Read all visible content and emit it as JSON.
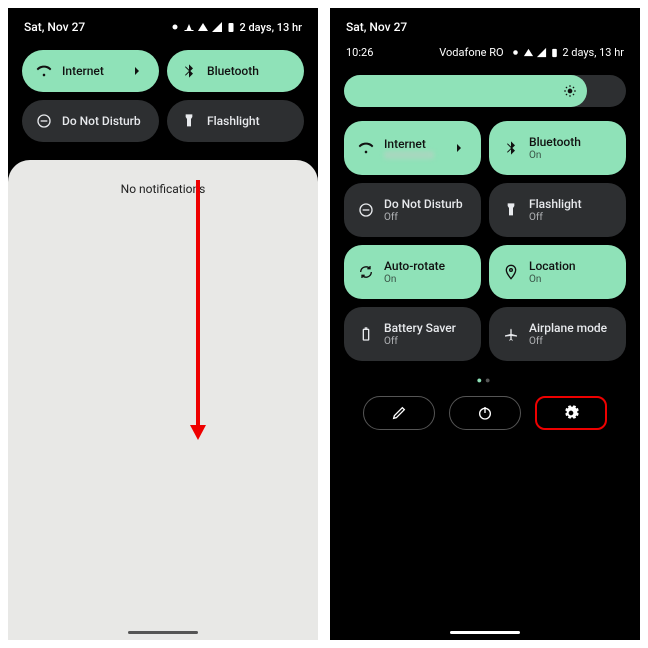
{
  "left": {
    "date": "Sat, Nov 27",
    "battery_text": "2 days, 13 hr",
    "tiles": [
      {
        "label": "Internet",
        "state": "on",
        "icon": "wifi"
      },
      {
        "label": "Bluetooth",
        "state": "on",
        "icon": "bluetooth"
      },
      {
        "label": "Do Not Disturb",
        "state": "off",
        "icon": "dnd"
      },
      {
        "label": "Flashlight",
        "state": "off",
        "icon": "flashlight"
      }
    ],
    "no_notifications": "No notifications"
  },
  "right": {
    "date": "Sat, Nov 27",
    "time": "10:26",
    "carrier": "Vodafone RO",
    "battery_text": "2 days, 13 hr",
    "tiles": [
      {
        "label": "Internet",
        "sub": "",
        "state": "on",
        "icon": "wifi"
      },
      {
        "label": "Bluetooth",
        "sub": "On",
        "state": "on",
        "icon": "bluetooth"
      },
      {
        "label": "Do Not Disturb",
        "sub": "Off",
        "state": "off",
        "icon": "dnd"
      },
      {
        "label": "Flashlight",
        "sub": "Off",
        "state": "off",
        "icon": "flashlight"
      },
      {
        "label": "Auto-rotate",
        "sub": "On",
        "state": "on",
        "icon": "rotate"
      },
      {
        "label": "Location",
        "sub": "On",
        "state": "on",
        "icon": "location"
      },
      {
        "label": "Battery Saver",
        "sub": "Off",
        "state": "off",
        "icon": "battery"
      },
      {
        "label": "Airplane mode",
        "sub": "Off",
        "state": "off",
        "icon": "airplane"
      }
    ]
  }
}
